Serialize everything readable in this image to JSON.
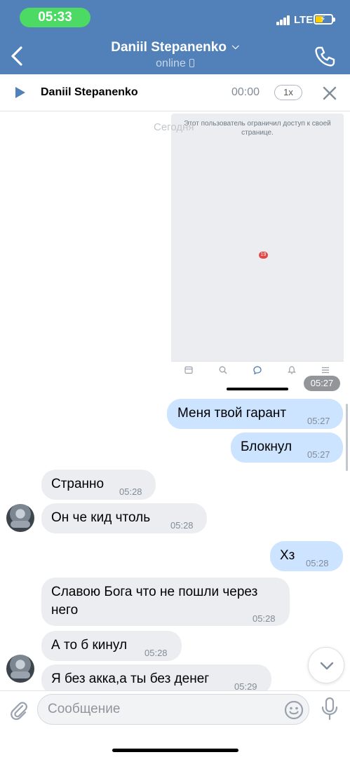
{
  "status_bar": {
    "time": "05:33",
    "network": "LTE"
  },
  "header": {
    "contact_name": "Daniil Stepanenko",
    "status": "online"
  },
  "player": {
    "name": "Daniil Stepanenko",
    "time": "00:00",
    "speed": "1x"
  },
  "chat": {
    "date": "Сегодня",
    "screenshot": {
      "text": "Этот пользователь ограничил доступ к своей странице.",
      "badge": "19",
      "time": "05:27"
    },
    "messages": [
      {
        "text": "Меня твой гарант",
        "time": "05:27",
        "direction": "out"
      },
      {
        "text": "Блокнул",
        "time": "05:27",
        "direction": "out"
      },
      {
        "text": "Странно",
        "time": "05:28",
        "direction": "in"
      },
      {
        "text": "Он че кид чтоль",
        "time": "05:28",
        "direction": "in"
      },
      {
        "text": "Хз",
        "time": "05:28",
        "direction": "out"
      },
      {
        "text": "Славою Бога что не пошли через него",
        "time": "05:28",
        "direction": "in"
      },
      {
        "text": "А то б кинул",
        "time": "05:28",
        "direction": "in"
      },
      {
        "text": "Я без акка,а ты без денег",
        "time": "05:29",
        "direction": "in"
      }
    ]
  },
  "composer": {
    "placeholder": "Сообщение"
  },
  "colors": {
    "header": "#5181b8",
    "outgoing_bubble": "#cce4ff",
    "incoming_bubble": "#ebedf0",
    "status_pill": "#4cd964"
  }
}
